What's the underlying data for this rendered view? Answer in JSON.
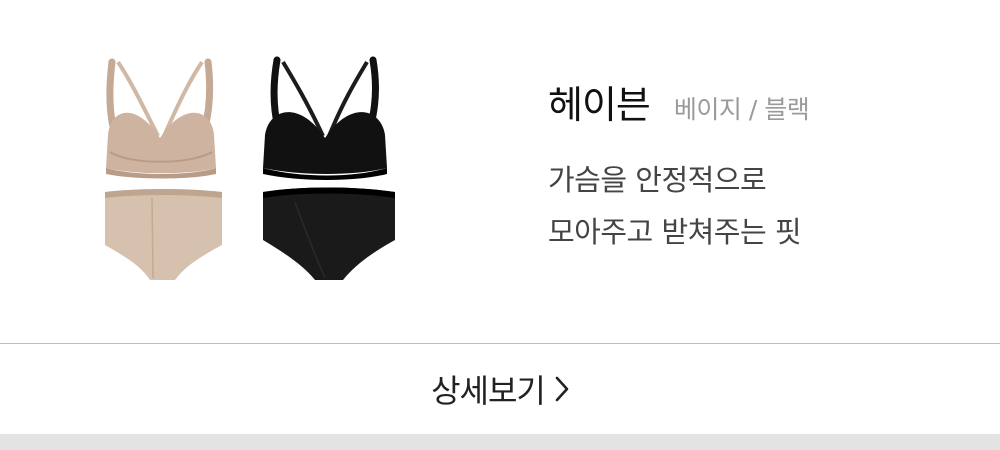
{
  "product": {
    "name": "헤이븐",
    "colors": "베이지 / 블랙",
    "description_lines": [
      "가슴을 안정적으로",
      "모아주고 받쳐주는 핏"
    ],
    "swatches": {
      "beige": "#cdb3a0",
      "beige_dark": "#b99c88",
      "black": "#111111"
    }
  },
  "detail_button": {
    "label": "상세보기",
    "icon": "chevron-right-icon"
  },
  "theme": {
    "divider": "#bdbdbd",
    "footer": "#e3e3e3"
  }
}
